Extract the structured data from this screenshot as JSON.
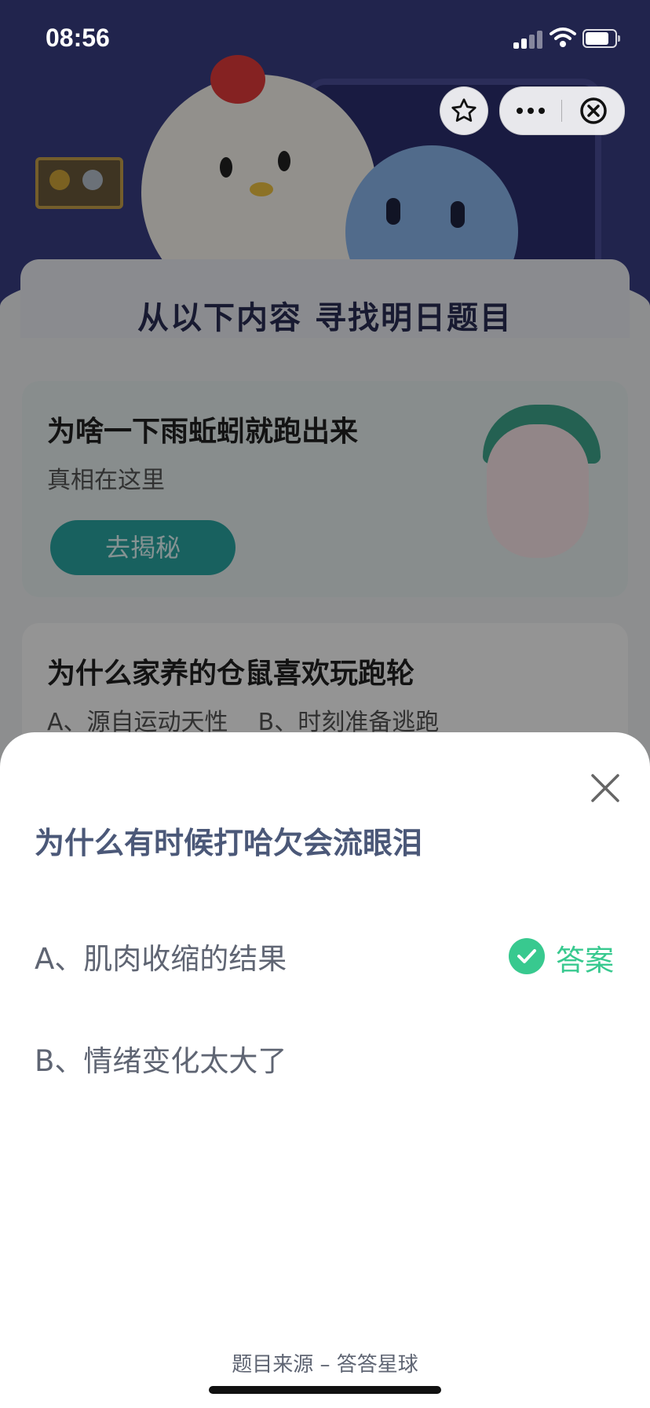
{
  "status_bar": {
    "time": "08:56",
    "battery_level": 0.8
  },
  "capsule": {
    "favorite_icon": "star-icon",
    "more_icon": "ellipsis-icon",
    "close_icon": "close-circle-icon"
  },
  "background": {
    "header_title": "从以下内容 寻找明日题目",
    "cards": [
      {
        "title": "为啥一下雨蚯蚓就跑出来",
        "subtitle": "真相在这里",
        "button_label": "去揭秘"
      },
      {
        "title": "为什么家养的仓鼠喜欢玩跑轮",
        "options_line": "A、源自运动天性    B、时刻准备逃跑"
      }
    ]
  },
  "sheet": {
    "question": "为什么有时候打哈欠会流眼泪",
    "options": [
      {
        "label": "A、肌肉收缩的结果",
        "is_answer": true
      },
      {
        "label": "B、情绪变化太大了",
        "is_answer": false
      }
    ],
    "answer_badge": "答案",
    "source": "题目来源 – 答答星球"
  },
  "colors": {
    "accent_green": "#38c98f",
    "question_text": "#4b5878",
    "option_text": "#5f6573"
  }
}
